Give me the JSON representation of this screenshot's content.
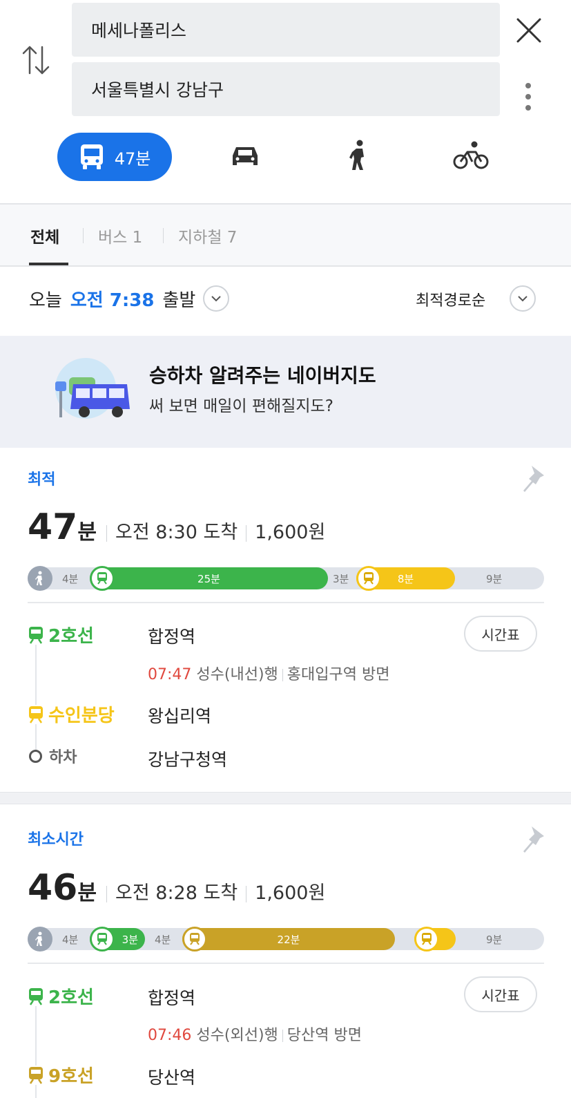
{
  "search": {
    "origin": "메세나폴리스",
    "destination": "서울특별시 강남구"
  },
  "modes": {
    "transit_time": "47분"
  },
  "tabs": [
    {
      "label": "전체"
    },
    {
      "label": "버스 1"
    },
    {
      "label": "지하철 7"
    }
  ],
  "depart": {
    "today": "오늘",
    "time": "오전 7:38",
    "suffix": "출발",
    "sort": "최적경로순"
  },
  "banner": {
    "title": "승하차 알려주는 네이버지도",
    "subtitle": "써 보면 매일이 편해질지도?"
  },
  "colors": {
    "accent": "#1a73e8",
    "line2": "#3cb44b",
    "suin": "#f5c518",
    "line9": "#c9a227",
    "time_red": "#e0483e"
  },
  "routes": [
    {
      "label": "최적",
      "duration_num": "47",
      "duration_unit": "분",
      "arrival": "오전 8:30 도착",
      "fare": "1,600원",
      "segments": {
        "walk1": "4분",
        "ride1": "25분",
        "walk2": "3분",
        "ride2": "8분",
        "walk3": "9분"
      },
      "steps": [
        {
          "line": "2호선",
          "station": "합정역",
          "time": "07:47",
          "direction": "성수(내선)행",
          "exit": "홍대입구역 방면"
        },
        {
          "line": "수인분당",
          "station": "왕십리역"
        },
        {
          "line": "하차",
          "station": "강남구청역"
        }
      ],
      "timetable": "시간표"
    },
    {
      "label": "최소시간",
      "duration_num": "46",
      "duration_unit": "분",
      "arrival": "오전 8:28 도착",
      "fare": "1,600원",
      "segments": {
        "walk1": "4분",
        "ride1": "3분",
        "walk2": "4분",
        "ride2": "22분",
        "walk3": "9분"
      },
      "steps": [
        {
          "line": "2호선",
          "station": "합정역",
          "time": "07:46",
          "direction": "성수(외선)행",
          "exit": "당산역 방면"
        },
        {
          "line": "9호선",
          "station": "당산역"
        }
      ],
      "timetable": "시간표"
    }
  ]
}
